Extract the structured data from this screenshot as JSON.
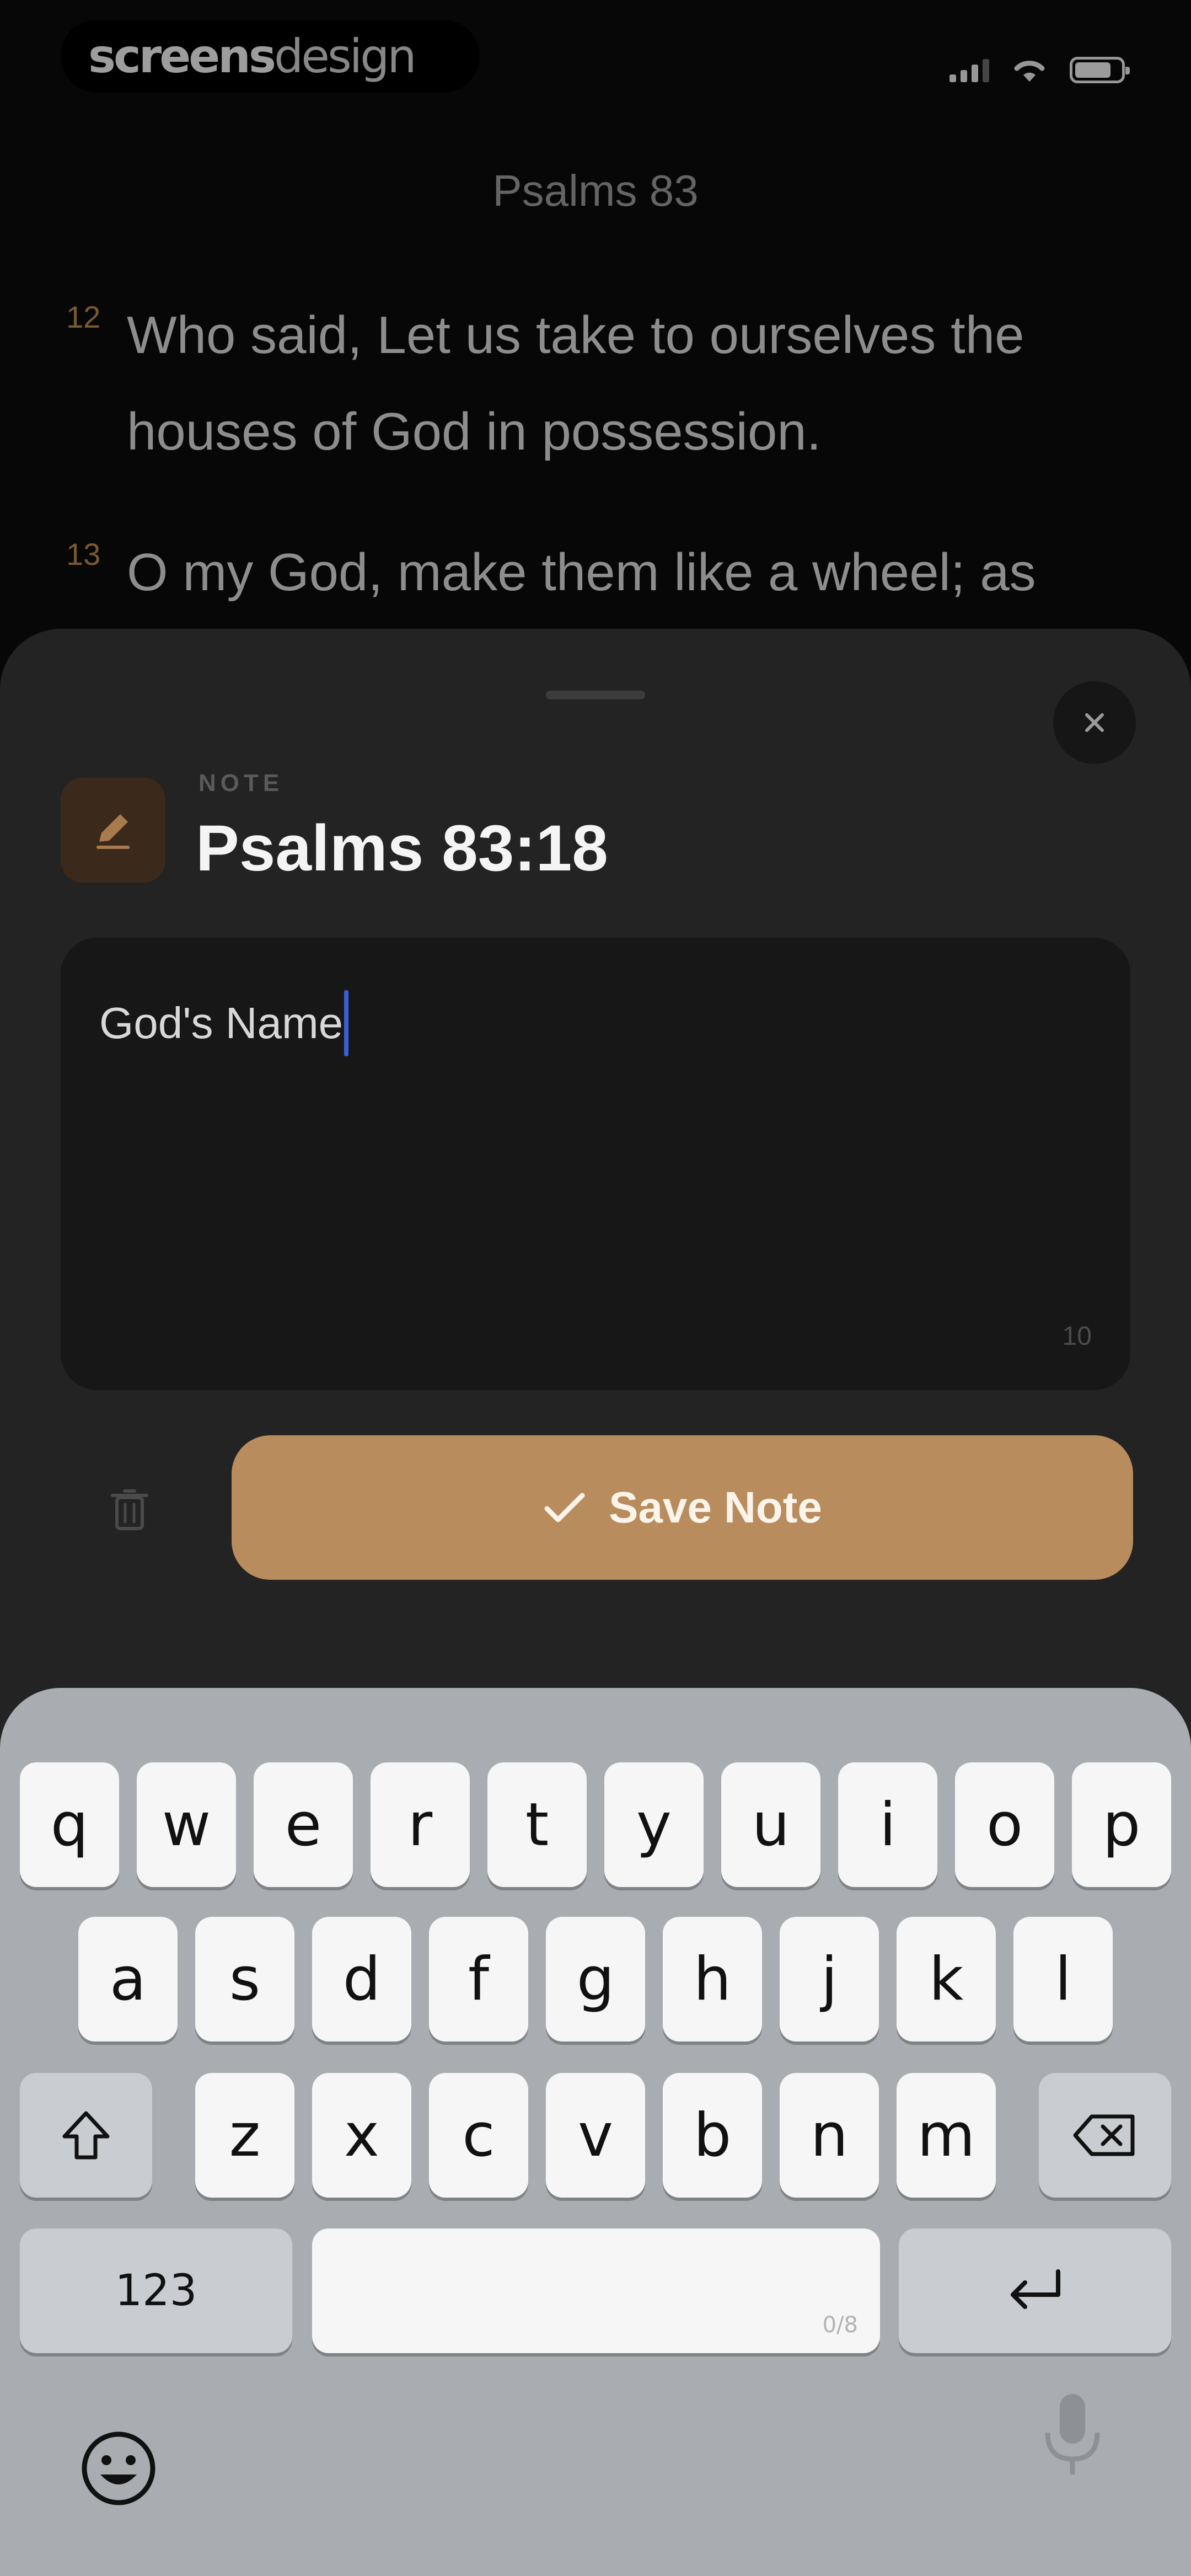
{
  "status_bar": {
    "brand_bold": "screens",
    "brand_light": "design"
  },
  "reader": {
    "chapter_title": "Psalms 83",
    "verses": [
      {
        "num": "12",
        "text": "Who said, Let us take to ourselves the houses of God in possession."
      },
      {
        "num": "13",
        "text": "O my God, make them like a wheel; as"
      }
    ]
  },
  "note_sheet": {
    "caption": "NOTE",
    "title": "Psalms 83:18",
    "note_value": "God's Name",
    "char_count": "10",
    "save_label": "Save Note",
    "icons": {
      "close": "close-icon",
      "note": "pencil-icon",
      "trash": "trash-icon",
      "save": "checkmark-icon"
    },
    "accent_color": "#b98c5e"
  },
  "keyboard": {
    "row1": [
      "q",
      "w",
      "e",
      "r",
      "t",
      "y",
      "u",
      "i",
      "o",
      "p"
    ],
    "row2": [
      "a",
      "s",
      "d",
      "f",
      "g",
      "h",
      "j",
      "k",
      "l"
    ],
    "row3": [
      "z",
      "x",
      "c",
      "v",
      "b",
      "n",
      "m"
    ],
    "numbers_label": "123",
    "space_hint": "0/8",
    "icons": {
      "shift": "shift-icon",
      "backspace": "backspace-icon",
      "return": "return-icon",
      "emoji": "emoji-icon",
      "dictation": "microphone-icon"
    }
  }
}
